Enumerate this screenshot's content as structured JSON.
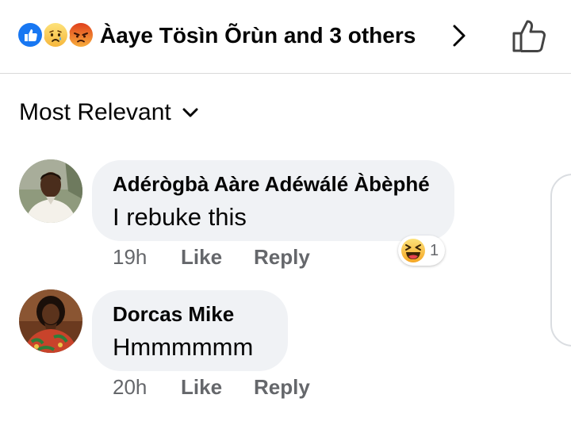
{
  "reactions_bar": {
    "icons": [
      "like-icon",
      "sad-icon",
      "angry-icon"
    ],
    "reactors_text": "Àaye Tösìn Õrùn and 3 others"
  },
  "sort": {
    "label": "Most Relevant"
  },
  "comments": [
    {
      "author": "Adérògbà Aàre Adéwálé Àbèphé",
      "text": "I rebuke this",
      "time": "19h",
      "like_label": "Like",
      "reply_label": "Reply",
      "reaction_icon": "laughing-icon",
      "reaction_count": "1"
    },
    {
      "author": "Dorcas Mike",
      "text": "Hmmmmmm",
      "time": "20h",
      "like_label": "Like",
      "reply_label": "Reply"
    }
  ],
  "colors": {
    "like_blue": "#1877f2",
    "bubble_bg": "#f0f2f5",
    "meta_gray": "#65676b",
    "text_dark": "#050505"
  }
}
